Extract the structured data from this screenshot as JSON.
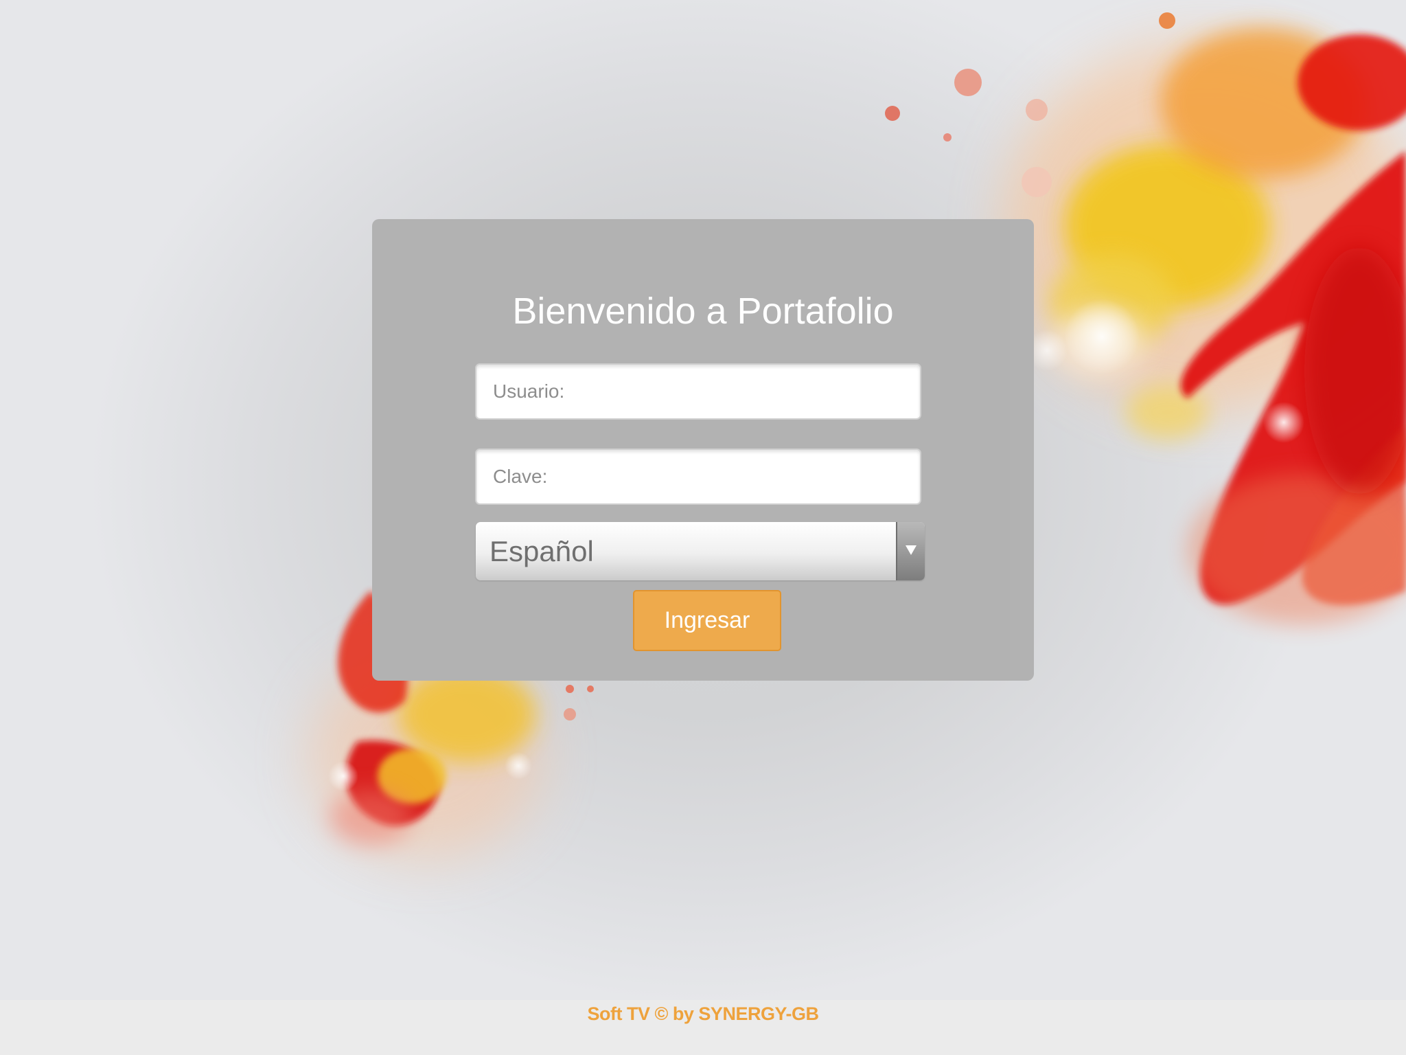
{
  "login": {
    "title": "Bienvenido a Portafolio",
    "username_placeholder": "Usuario:",
    "password_placeholder": "Clave:",
    "language_selected": "Español",
    "submit_label": "Ingresar"
  },
  "footer": {
    "text": "Soft TV © by SYNERGY-GB"
  },
  "colors": {
    "panel": "#b2b2b2",
    "button": "#eeaa4c",
    "footer_text": "#eea23c",
    "accent_red": "#e01010",
    "accent_yellow": "#f2c02a"
  },
  "icons": {
    "dropdown": "triangle-down-icon"
  }
}
